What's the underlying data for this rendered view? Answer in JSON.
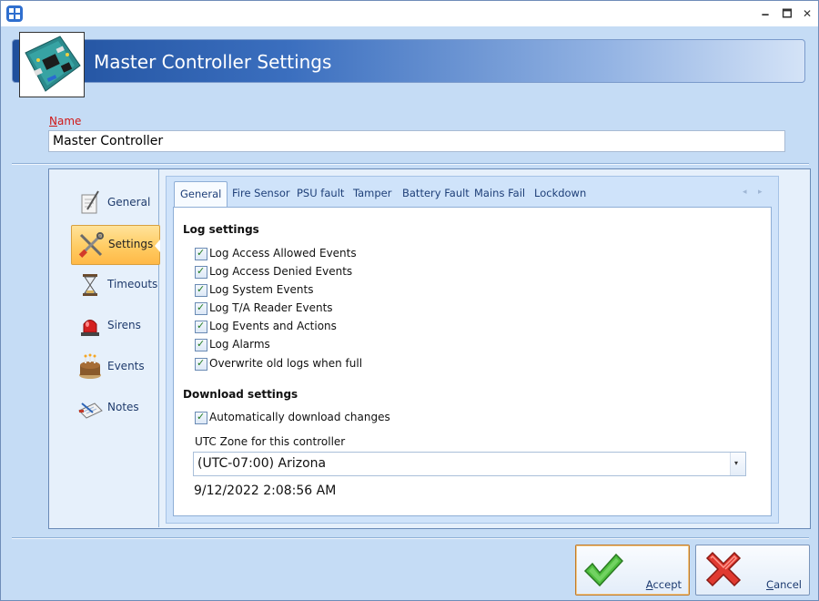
{
  "window": {
    "minimize_glyph": "🗕",
    "maximize_glyph": "🗖",
    "close_glyph": "✕"
  },
  "header": {
    "title": "Master Controller Settings",
    "image_icon": "controller-board-icon"
  },
  "name_field": {
    "label_accel": "N",
    "label_rest": "ame",
    "value": "Master Controller"
  },
  "side_nav": {
    "items": [
      {
        "label": "General",
        "icon": "notepad-pen-icon",
        "selected": false
      },
      {
        "label": "Settings",
        "icon": "tools-icon",
        "selected": true
      },
      {
        "label": "Timeouts",
        "icon": "hourglass-icon",
        "selected": false
      },
      {
        "label": "Sirens",
        "icon": "siren-icon",
        "selected": false
      },
      {
        "label": "Events",
        "icon": "cake-icon",
        "selected": false
      },
      {
        "label": "Notes",
        "icon": "notes-icon",
        "selected": false
      }
    ]
  },
  "tabs": {
    "items": [
      {
        "label": "General",
        "active": true
      },
      {
        "label": "Fire Sensor",
        "active": false
      },
      {
        "label": "PSU fault",
        "active": false
      },
      {
        "label": "Tamper",
        "active": false
      },
      {
        "label": "Battery Fault",
        "active": false
      },
      {
        "label": "Mains Fail",
        "active": false
      },
      {
        "label": "Lockdown",
        "active": false
      }
    ],
    "scroll_left": "◂",
    "scroll_right": "▸"
  },
  "log_settings": {
    "title": "Log settings",
    "options": [
      {
        "label": "Log Access Allowed Events",
        "checked": true
      },
      {
        "label": "Log Access Denied Events",
        "checked": true
      },
      {
        "label": "Log System Events",
        "checked": true
      },
      {
        "label": "Log T/A Reader Events",
        "checked": true
      },
      {
        "label": "Log Events and Actions",
        "checked": true
      },
      {
        "label": "Log Alarms",
        "checked": true
      },
      {
        "label": "Overwrite old logs when full",
        "checked": true
      }
    ]
  },
  "download_settings": {
    "title": "Download settings",
    "auto_download": {
      "label": "Automatically download changes",
      "checked": true
    },
    "utc_label": "UTC Zone for this controller",
    "utc_value": "(UTC-07:00) Arizona",
    "datetime": "9/12/2022  2:08:56 AM"
  },
  "check_glyph": "✓",
  "dropdown_glyph": "▾",
  "buttons": {
    "accept": {
      "accel": "A",
      "rest": "ccept",
      "icon": "green-check-icon"
    },
    "cancel": {
      "accel": "C",
      "rest": "ancel",
      "icon": "red-x-icon"
    }
  },
  "colors": {
    "header_gradient_start": "#1f4f9c",
    "selected_nav": "#ffcc63",
    "accept_check": "#3aa53a",
    "cancel_x": "#d42a2a",
    "name_label": "#d01818"
  }
}
